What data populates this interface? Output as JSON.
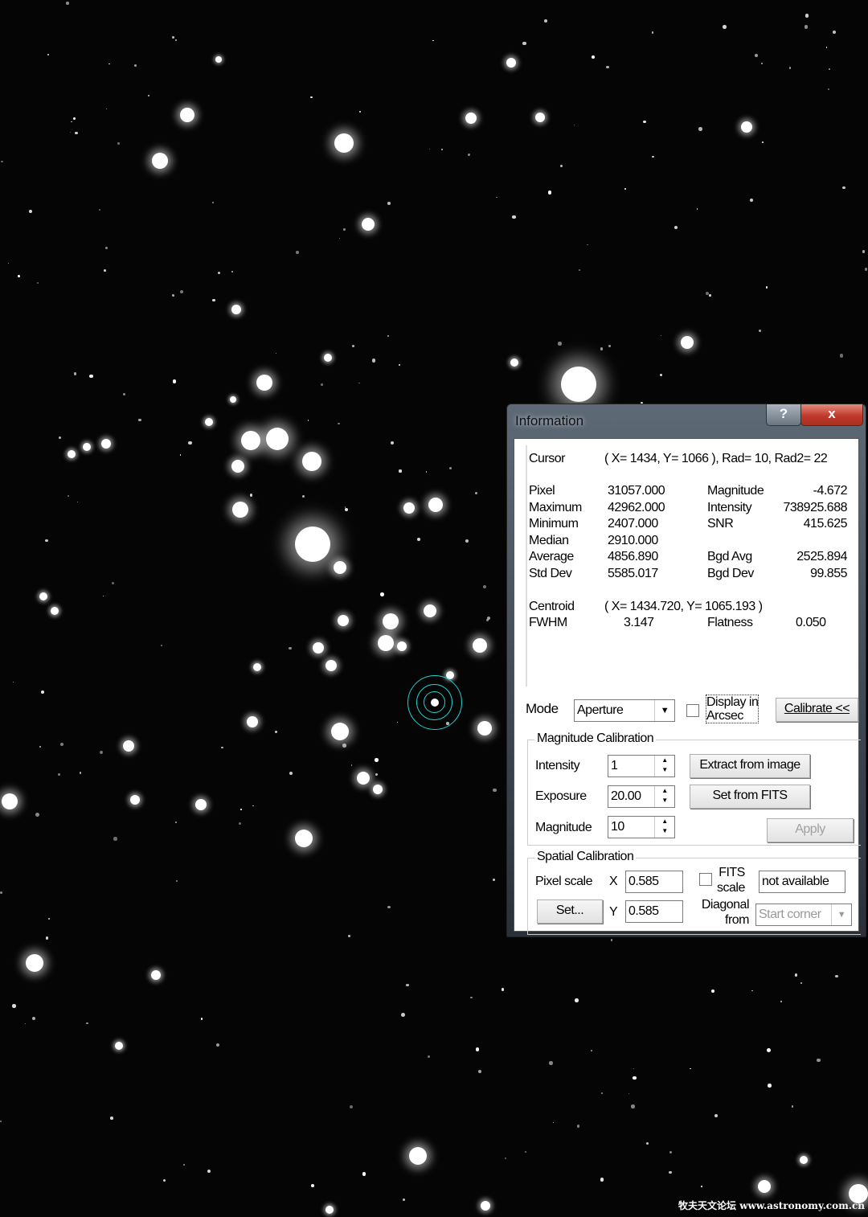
{
  "window": {
    "title": "Information",
    "help_label": "?",
    "close_label": "x"
  },
  "info": {
    "cursor_label": "Cursor",
    "cursor_value": "( X= 1434, Y= 1066 ), Rad= 10, Rad2= 22",
    "stats_left": [
      {
        "label": "Pixel",
        "value": "31057.000"
      },
      {
        "label": "Maximum",
        "value": "42962.000"
      },
      {
        "label": "Minimum",
        "value": "2407.000"
      },
      {
        "label": "Median",
        "value": "2910.000"
      },
      {
        "label": "Average",
        "value": "4856.890"
      },
      {
        "label": "Std Dev",
        "value": "5585.017"
      }
    ],
    "stats_right": [
      {
        "label": "Magnitude",
        "value": "-4.672"
      },
      {
        "label": "Intensity",
        "value": "738925.688"
      },
      {
        "label": "SNR",
        "value": "415.625"
      },
      {
        "label": "",
        "value": ""
      },
      {
        "label": "Bgd Avg",
        "value": "2525.894"
      },
      {
        "label": "Bgd Dev",
        "value": "99.855"
      }
    ],
    "centroid_label": "Centroid",
    "centroid_value": "( X= 1434.720, Y= 1065.193 )",
    "fwhm_label": "FWHM",
    "fwhm_value": "3.147",
    "flatness_label": "Flatness",
    "flatness_value": "0.050"
  },
  "mode": {
    "label": "Mode",
    "selected": "Aperture",
    "display_arcsec_line1": "Display in",
    "display_arcsec_line2": "Arcsec",
    "display_arcsec_checked": false,
    "calibrate_label": "Calibrate <<"
  },
  "magcal": {
    "title": "Magnitude Calibration",
    "intensity_label": "Intensity",
    "intensity_value": "1",
    "exposure_label": "Exposure",
    "exposure_value": "20.00",
    "magnitude_label": "Magnitude",
    "magnitude_value": "10",
    "extract_label": "Extract from image",
    "setfits_label": "Set from FITS",
    "apply_label": "Apply"
  },
  "spatial": {
    "title": "Spatial Calibration",
    "pixel_scale_label": "Pixel scale",
    "x_label": "X",
    "x_value": "0.585",
    "y_label": "Y",
    "y_value": "0.585",
    "set_label": "Set...",
    "fits_line1": "FITS",
    "fits_line2": "scale",
    "fits_checked": false,
    "fits_value": "not available",
    "diag_line1": "Diagonal",
    "diag_line2": "from",
    "diag_selected": "Start corner"
  },
  "watermark": "牧夫天文论坛 www.astronomy.com.cn",
  "colors": {
    "aperture_ring": "#1ed0d0",
    "close_button": "#c0392b"
  }
}
